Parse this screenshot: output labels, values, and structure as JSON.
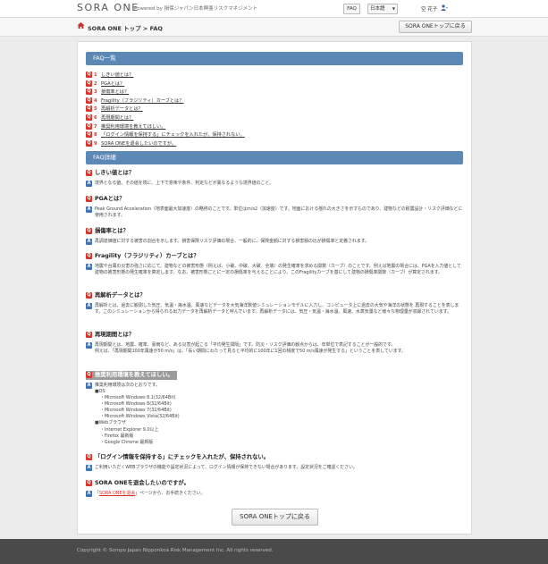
{
  "header": {
    "logo": "SORA ONE",
    "tagline": "Powered by 損保ジャパン日本興亜リスクマネジメント",
    "faq_label": "FAQ",
    "lang": "日本語",
    "lang_arrow": "▼",
    "user": "空 花子",
    "user_icon": "user-icon"
  },
  "breadcrumb": {
    "text": "SORA ONE トップ > FAQ",
    "back_label": "SORA ONEトップに戻る"
  },
  "toc": {
    "heading": "FAQ一覧",
    "items": [
      {
        "num": "1",
        "label": "しきい値とは？"
      },
      {
        "num": "2",
        "label": "PGAとは？"
      },
      {
        "num": "3",
        "label": "損傷率とは？"
      },
      {
        "num": "4",
        "label": "Fragility（フラジリティ）カーブとは？"
      },
      {
        "num": "5",
        "label": "再解析データとは？"
      },
      {
        "num": "6",
        "label": "再現期間とは？"
      },
      {
        "num": "7",
        "label": "推奨利用環境を教えてほしい。"
      },
      {
        "num": "8",
        "label": "「ログイン情報を保持する」にチェックを入れたが、保持されない。"
      },
      {
        "num": "9",
        "label": "SORA ONEを退会したいのですが。"
      }
    ]
  },
  "detail": {
    "heading": "FAQ詳細",
    "q_badge": "Q",
    "a_badge": "A",
    "q1": {
      "q": "しきい値とは？",
      "a": "境界となる値。その値を境に、上下で意味や条件、判定などが異なるような境界値のこと。"
    },
    "q2": {
      "q": "PGAとは？",
      "a": "Peak Ground Acceleration（地表面最大加速度）の略称のことです。単位はm/s2（加速度）です。地面における揺れの大きさを示すものであり、建物などの耐震設計・リスク評価などに使用されます。"
    },
    "q3": {
      "q": "損傷率とは？",
      "a": "再調達価値に対する被害の割合を示します。損害保険リスク評価の場合、一般的に、保険金額に対する損害額の比が損傷率と定義されます。"
    },
    "q4": {
      "q": "Fragility（フラジリティ）カーブとは？",
      "a": "地震や台風の災害の強さに応じて、建物などの被害形態（例えば、小破、中破、大破、全壊）の発生確率を求める関数（カーブ）のことです。例えば地震の場合には、PGAを入力値として建物の被害形態の発生確率を算定します。なお、被害形態ごとに一定の損傷率を与えることにより、このFragilityカーブを基にして建物の損傷率関数（カーブ）が算定されます。"
    },
    "q5": {
      "q": "再解析データとは？",
      "a": "再解析とは、過去に観測した気圧、気温・海水温、風速などデータを大気海洋数値シミュレーションモデルに入力し、コンピュータ上に過去の大気や海洋の状態を 再現することを表します。このシミュレーションから得られる出力データを再解析データと呼んでいます。再解析データには、気圧・気温・海水温、風速、水蒸気量など様々な物理量が収録されています。"
    },
    "q6": {
      "q": "再現期間とは？",
      "a1": "再現期間とは、地震、確率、豪雨など、ある災害が起こる「平均発生間隔」です。防災・リスク評価の観点からは、年単位で表記することが一般的です。",
      "a2": "例えば、「再現期間100年風速が50 m/s」は、「長い期間にわたって見ると平均的に100年に1回の頻度で50 m/s風速が発生する」ということを表しています。"
    },
    "q7": {
      "q": "推奨利用環境を教えてほしい。",
      "intro": "推奨利用環境は次のとおりです。",
      "env": [
        {
          "text": "■OS",
          "sub": false
        },
        {
          "text": "・Microsoft Windows 8.1(32/64Bit)",
          "sub": true
        },
        {
          "text": "・Microsoft Windows 8(32/64Bit)",
          "sub": true
        },
        {
          "text": "・Microsoft Windows 7(32/64Bit)",
          "sub": true
        },
        {
          "text": "・Microsoft Windows Vista(32/64Bit)",
          "sub": true
        },
        {
          "text": "■Webブラウザ",
          "sub": false
        },
        {
          "text": "・Internet Explorer 9.0以上",
          "sub": true
        },
        {
          "text": "・Firefox 最新版",
          "sub": true
        },
        {
          "text": "・Google Chrome 最新版",
          "sub": true
        }
      ]
    },
    "q8": {
      "q": "「ログイン情報を保持する」にチェックを入れたが、保持されない。",
      "a": "ご利用いただくWEBブラウザの機能や設定状況によって、ログイン情報が保持できない場合があります。設定状況をご確認ください。"
    },
    "q9": {
      "q": "SORA ONEを退会したいのですが。",
      "a_pre": "「",
      "a_link": "SORA ONEを退会",
      "a_post": "」ページから、お手続きください。"
    }
  },
  "bottom_button": "SORA ONEトップに戻る",
  "footer": "Copyright © Sompo Japan Nipponkoa Risk Management Inc. All rights reserved.",
  "colors": {
    "accent": "#5b88b5",
    "q_red": "#d9332a",
    "a_blue": "#3d74b8",
    "footer": "#4a4a4a"
  }
}
